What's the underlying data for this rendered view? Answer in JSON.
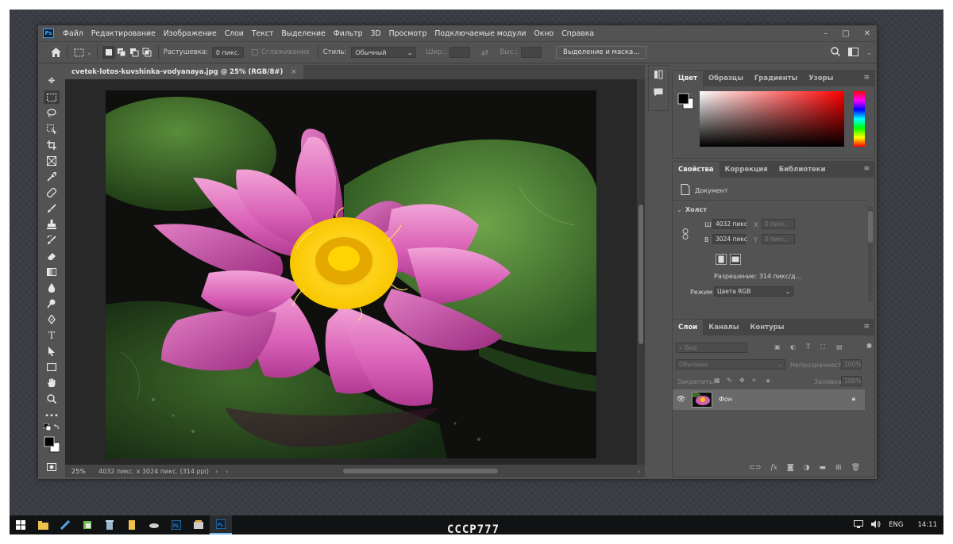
{
  "menubar": {
    "app_icon": "Ps",
    "items": [
      "Файл",
      "Редактирование",
      "Изображение",
      "Слои",
      "Текст",
      "Выделение",
      "Фильтр",
      "3D",
      "Просмотр",
      "Подключаемые модули",
      "Окно",
      "Справка"
    ]
  },
  "window_controls": {
    "minimize": "–",
    "maximize": "□",
    "close": "✕"
  },
  "options_bar": {
    "feather_label": "Растушевка:",
    "feather_value": "0 пикс.",
    "antialias_label": "Сглаживание",
    "style_label": "Стиль:",
    "style_value": "Обычный",
    "width_label": "Шир.:",
    "height_label": "Выс.:",
    "select_mask_button": "Выделение и маска..."
  },
  "document": {
    "tab_title": "cvetok-lotos-kuvshinka-vodyanaya.jpg @ 25% (RGB/8#)",
    "tab_close": "×",
    "zoom": "25%",
    "status_info": "4032 пикс. x 3024 пикс. (314 ppi)"
  },
  "color_panel": {
    "tabs": [
      "Цвет",
      "Образцы",
      "Градиенты",
      "Узоры"
    ]
  },
  "properties_panel": {
    "tabs": [
      "Свойства",
      "Коррекция",
      "Библиотеки"
    ],
    "doc_label": "Документ",
    "canvas_section": "Холст",
    "width_label": "Ш",
    "width_value": "4032 пикс",
    "x_label": "X",
    "x_placeholder": "0 пикс.",
    "height_label": "В",
    "height_value": "3024 пикс",
    "y_label": "Y",
    "y_placeholder": "0 пикс.",
    "resolution": "Разрешение: 314 пикс/д...",
    "mode_label": "Режим",
    "mode_value": "Цвета RGB"
  },
  "layers_panel": {
    "tabs": [
      "Слои",
      "Каналы",
      "Контуры"
    ],
    "search_placeholder": "Вид",
    "blend_mode": "Обычные",
    "opacity_label": "Непрозрачность:",
    "opacity_value": "100%",
    "lock_label": "Закрепить:",
    "fill_label": "Заливка:",
    "fill_value": "100%",
    "layer_name": "Фон"
  },
  "taskbar": {
    "lang": "ENG",
    "time": "14:11"
  },
  "watermark": "CCCP777",
  "colors": {
    "ps_bg": "#535353",
    "panel_dark": "#454545",
    "canvas_bg": "#282828",
    "accent_blue": "#31a8ff",
    "taskbar": "#111214"
  }
}
